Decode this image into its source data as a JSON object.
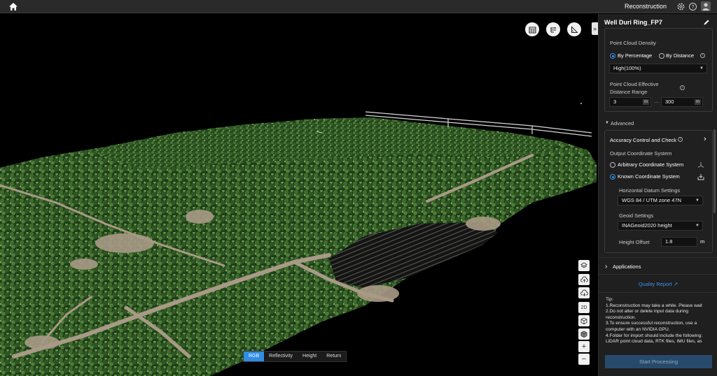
{
  "topbar": {
    "title": "Reconstruction",
    "icons": [
      "home-icon",
      "settings-icon",
      "help-icon",
      "user-icon"
    ]
  },
  "viewport": {
    "view_tools": [
      "calendar-grid-icon",
      "route-icon",
      "measure-icon"
    ],
    "mode_tabs": [
      {
        "label": "RGB",
        "active": true
      },
      {
        "label": "Reflectivity",
        "active": false
      },
      {
        "label": "Height",
        "active": false
      },
      {
        "label": "Return",
        "active": false
      }
    ],
    "side_tools": {
      "layers": [
        "layers-icon"
      ],
      "cloud": [
        "cloud-upload-icon",
        "cloud-download-icon"
      ],
      "views": [
        "2D",
        "3d-box-icon",
        "cube-icon"
      ],
      "zoom": [
        "+",
        "−"
      ]
    },
    "colors": {
      "vegetation_dark": "#1f3d1a",
      "vegetation_mid": "#3e6b2c",
      "vegetation_light": "#7aa55a",
      "ground": "#a89a86"
    }
  },
  "panel": {
    "title": "Well Duri Ring_FP7",
    "density": {
      "label": "Point Cloud Density",
      "by_percentage": "By Percentage",
      "by_distance": "By Distance",
      "selected_value": "High(100%)"
    },
    "range": {
      "label_line1": "Point Cloud Effective",
      "label_line2": "Distance Range",
      "min": "3",
      "max": "300",
      "unit": "m",
      "separator": "—"
    },
    "advanced": {
      "label": "Advanced",
      "accuracy": "Accuracy Control and Check",
      "output_cs": "Output Coordinate System",
      "arbitrary": "Arbitrary Coordinate System",
      "known": "Known Coordinate System",
      "horizontal_label": "Horizontal Datum Settings",
      "horizontal_value": "WGS 84 / UTM zone 47N",
      "geoid_label": "Geoid Settings",
      "geoid_value": "INAGeoid2020 height",
      "height_offset_label": "Height Offset",
      "height_offset_value": "1.8",
      "height_offset_unit": "m"
    },
    "applications": "Applications",
    "quality_report": "Quality Report",
    "tip": {
      "title": "Tip:",
      "lines": [
        "1.Reconstruction may take a while. Please wait",
        "2.Do not alter or delete input data during reconstruction.",
        "3.To ensure successful reconstruction, use a computer with an NVIDIA GPU.",
        "4.Folder for import should include the following: LiDAR point cloud data, RTK files, IMU files, as"
      ]
    },
    "start_button": "Start Processing"
  }
}
